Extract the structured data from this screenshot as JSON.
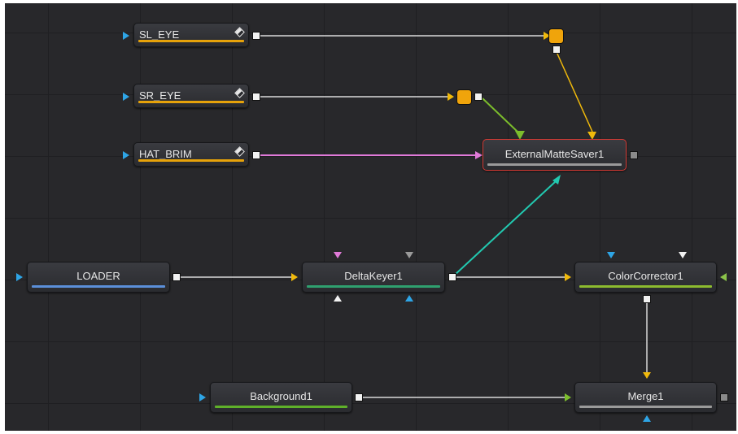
{
  "colors": {
    "background": "#28282b",
    "grid_line": "#1f1f22",
    "node_fill": "#313236",
    "wire_white": "#d9d9d9",
    "wire_orange": "#f0b90b",
    "wire_green": "#7cbd2c",
    "wire_pink": "#e07ad8",
    "wire_cyan": "#22c9b0",
    "selected_border": "#d23a34",
    "input_blue": "#2ea5e6"
  },
  "nodes": {
    "sl_eye": {
      "label": "SL_EYE",
      "bar_color": "#e6a20a",
      "has_diamond": true
    },
    "sr_eye": {
      "label": "SR_EYE",
      "bar_color": "#e6a20a",
      "has_diamond": true
    },
    "hat_brim": {
      "label": "HAT_BRIM",
      "bar_color": "#e6a20a",
      "has_diamond": true
    },
    "external_matte_saver": {
      "label": "ExternalMatteSaver1",
      "bar_color": "#9a9a9a",
      "selected": true
    },
    "loader": {
      "label": "LOADER",
      "bar_color": "#5b8fd9"
    },
    "delta_keyer": {
      "label": "DeltaKeyer1",
      "bar_color": "#2fa06f"
    },
    "color_corrector": {
      "label": "ColorCorrector1",
      "bar_color": "#8dbb2f"
    },
    "background": {
      "label": "Background1",
      "bar_color": "#5fb02a"
    },
    "merge": {
      "label": "Merge1",
      "bar_color": "#9a9a9a"
    }
  },
  "icons": {
    "keyframe": "diamond-keyframe-icon",
    "router": "pipe-router-icon",
    "input": "input-triangle-icon",
    "output": "output-square-icon"
  }
}
